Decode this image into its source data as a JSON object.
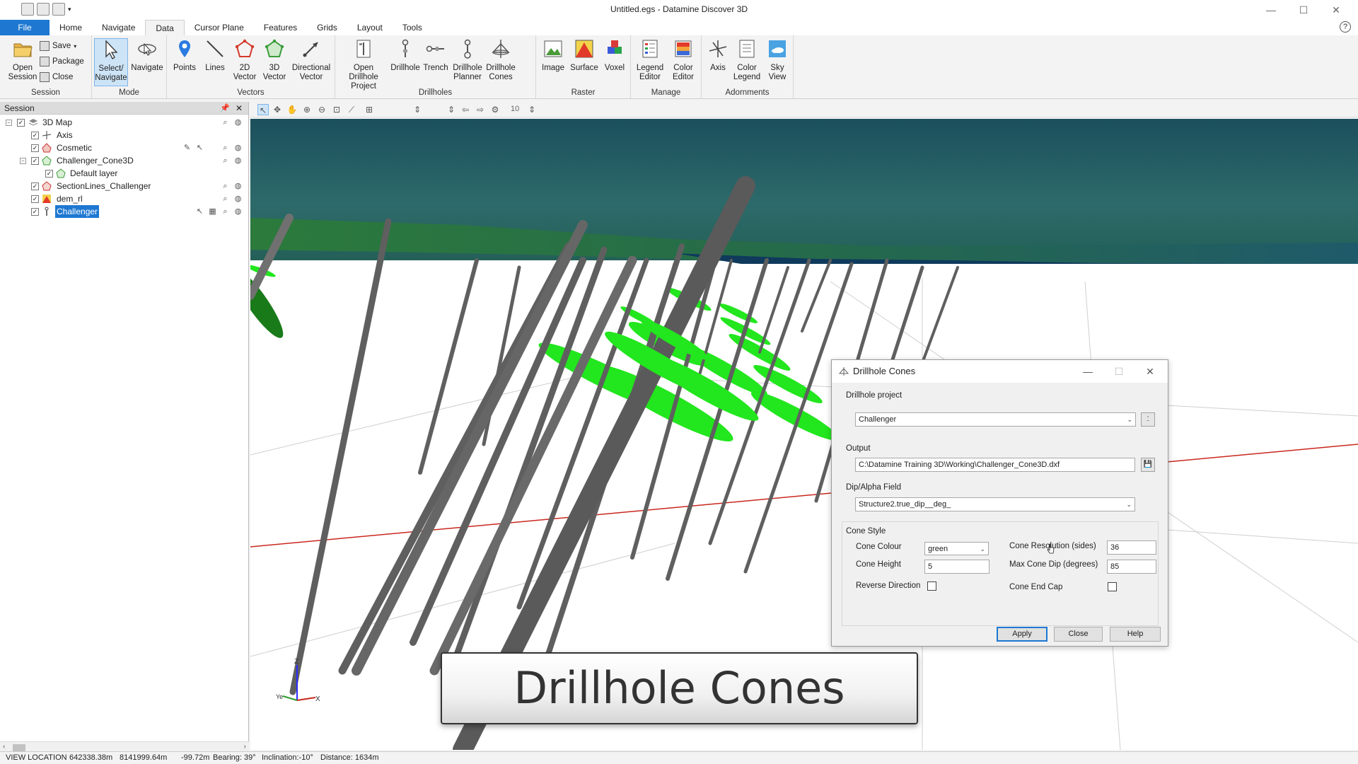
{
  "window": {
    "title": "Untitled.egs - Datamine Discover 3D",
    "controls": [
      "minimize",
      "maximize",
      "close"
    ]
  },
  "ribbon": {
    "tabs": [
      "File",
      "Home",
      "Navigate",
      "Data",
      "Cursor Plane",
      "Features",
      "Grids",
      "Layout",
      "Tools"
    ],
    "active_tab": "Data",
    "session": {
      "label": "Session",
      "open": "Open Session",
      "save": "Save",
      "package": "Package",
      "close": "Close"
    },
    "mode": {
      "label": "Mode",
      "select": "Select/ Navigate",
      "navigate": "Navigate"
    },
    "vectors": {
      "label": "Vectors",
      "points": "Points",
      "lines": "Lines",
      "vec2d": "2D Vector",
      "vec3d": "3D Vector",
      "directional": "Directional Vector"
    },
    "drillholes": {
      "label": "Drillholes",
      "open_project": "Open Drillhole Project",
      "drillhole": "Drillhole",
      "trench": "Trench",
      "planner": "Drillhole Planner",
      "cones": "Drillhole Cones"
    },
    "raster": {
      "label": "Raster",
      "image": "Image",
      "surface": "Surface",
      "voxel": "Voxel"
    },
    "manage": {
      "label": "Manage",
      "legend_editor": "Legend Editor",
      "color_editor": "Color Editor"
    },
    "adornments": {
      "label": "Adornments",
      "axis": "Axis",
      "color_legend": "Color Legend",
      "sky_view": "Sky View"
    }
  },
  "session_panel": {
    "title": "Session",
    "items": [
      {
        "label": "3D Map"
      },
      {
        "label": "Axis"
      },
      {
        "label": "Cosmetic"
      },
      {
        "label": "Challenger_Cone3D"
      },
      {
        "label": "Default layer"
      },
      {
        "label": "SectionLines_Challenger"
      },
      {
        "label": "dem_rl"
      },
      {
        "label": "Challenger"
      }
    ]
  },
  "view_toolbar": {
    "step_value": "10"
  },
  "viewport": {
    "axis_labels": {
      "z": "Z",
      "y": "Ye",
      "x": "X"
    },
    "colors": {
      "sky_top": "#1b4f5d",
      "sky_bottom": "#2d6a6a",
      "horizon": "#0f3a5c",
      "floor": "#ffffff",
      "hole": "#5f5f5f",
      "cone": "#22e61e",
      "section_line": "#c8281e"
    }
  },
  "dialog": {
    "title": "Drillhole Cones",
    "drillhole_project_label": "Drillhole project",
    "drillhole_project_value": "Challenger",
    "output_label": "Output",
    "output_value": "C:\\Datamine Training 3D\\Working\\Challenger_Cone3D.dxf",
    "dip_field_label": "Dip/Alpha Field",
    "dip_field_value": "Structure2.true_dip__deg_",
    "cone_style_label": "Cone Style",
    "cone_colour_label": "Cone Colour",
    "cone_colour_value": "green",
    "cone_height_label": "Cone Height",
    "cone_height_value": "5",
    "reverse_direction_label": "Reverse Direction",
    "cone_resolution_label": "Cone Resolution (sides)",
    "cone_resolution_value": "36",
    "max_cone_dip_label": "Max Cone Dip (degrees)",
    "max_cone_dip_value": "85",
    "cone_end_cap_label": "Cone End Cap",
    "apply": "Apply",
    "close": "Close",
    "help": "Help"
  },
  "caption": {
    "text": "Drillhole Cones"
  },
  "statusbar": {
    "view_location_label": "VIEW LOCATION",
    "easting": "642338.38m",
    "northing": "8141999.64m",
    "elevation": "-99.72m",
    "bearing": "Bearing: 39°",
    "inclination": "Inclination:-10°",
    "distance": "Distance: 1634m"
  }
}
